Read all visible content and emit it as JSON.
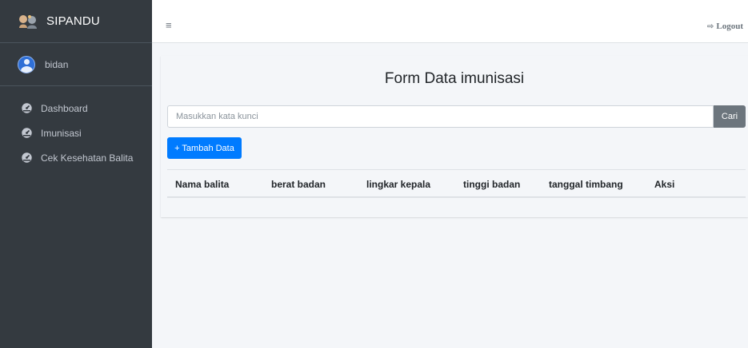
{
  "app": {
    "brand": "SIPANDU"
  },
  "user": {
    "name": "bidan"
  },
  "sidebar": {
    "items": [
      {
        "label": "Dashboard",
        "icon": "tachometer-icon"
      },
      {
        "label": "Imunisasi",
        "icon": "tachometer-icon"
      },
      {
        "label": "Cek Kesehatan Balita",
        "icon": "tachometer-icon"
      }
    ]
  },
  "topbar": {
    "menu_icon": "≡",
    "logout_label": "Logout",
    "logout_icon": "sign-out-icon"
  },
  "page": {
    "title": "Form Data imunisasi",
    "search_placeholder": "Masukkan kata kunci",
    "search_button": "Cari",
    "add_button": "+ Tambah Data"
  },
  "table": {
    "columns": [
      "Nama balita",
      "berat badan",
      "lingkar kepala",
      "tinggi badan",
      "tanggal timbang",
      "Aksi"
    ],
    "rows": []
  },
  "colors": {
    "sidebar_bg": "#343a40",
    "primary": "#007bff",
    "secondary": "#6c757d",
    "content_bg": "#f4f6f9"
  }
}
